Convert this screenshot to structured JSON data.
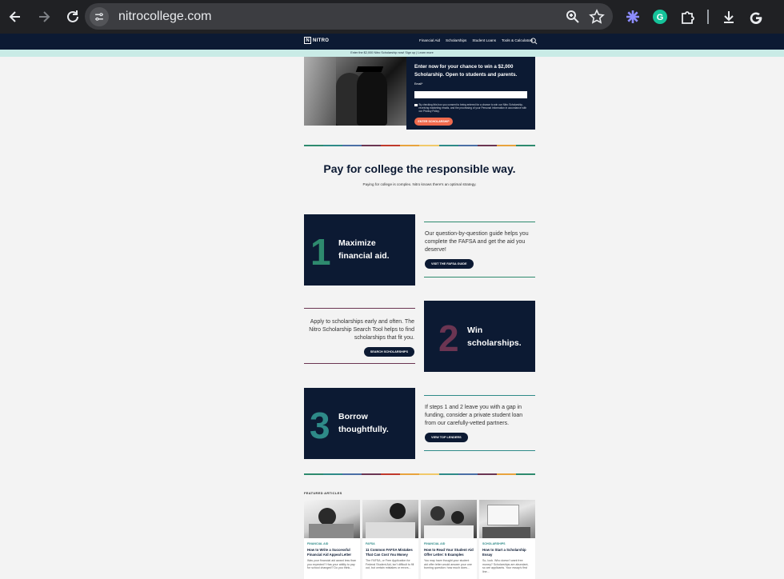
{
  "browser": {
    "url": "nitrocollege.com"
  },
  "site_nav": {
    "logo_text": "NITRO",
    "logo_box": "N",
    "menu": [
      "Financial Aid",
      "Scholarships",
      "Student Loans",
      "Tools & Calculators"
    ]
  },
  "promo_bar": {
    "text": "Enter the $2,000 Nitro Scholarship now! Sign up | Learn more"
  },
  "hero": {
    "title": "Enter now for your chance to win a $2,000 Scholarship. Open to students and parents.",
    "email_label": "Email*",
    "consent": "By checking this box you consent to being entered for a chance to win our Nitro Scholarship, receiving marketing emails, and the processing of your Personal Information in accordance with our Privacy Policy.",
    "button": "ENTER SCHOLARSHIP"
  },
  "section": {
    "heading": "Pay for college the responsible way.",
    "subheading": "Paying for college is complex. Nitro knows there's an optimal strategy."
  },
  "steps": [
    {
      "number": "1",
      "title_line1": "Maximize",
      "title_line2": "financial aid.",
      "description": "Our question-by-question guide helps you complete the FAFSA and get the aid you deserve!",
      "button": "VISIT THE FAFSA GUIDE",
      "accent": "#2e8a6e"
    },
    {
      "number": "2",
      "title_line1": "Win",
      "title_line2": "scholarships.",
      "description": "Apply to scholarships early and often. The Nitro Scholarship Search Tool helps to find scholarships that fit you.",
      "button": "SEARCH SCHOLARSHIPS",
      "accent": "#6b3552"
    },
    {
      "number": "3",
      "title_line1": "Borrow",
      "title_line2": "thoughtfully.",
      "description": "If steps 1 and 2 leave you with a gap in funding, consider a private student loan from our carefully-vetted partners.",
      "button": "VIEW TOP LENDERS",
      "accent": "#2e8a88"
    }
  ],
  "featured": {
    "label": "FEATURED ARTICLES",
    "articles": [
      {
        "category": "FINANCIAL AID",
        "title": "How to Write a Successful Financial Aid Appeal Letter",
        "excerpt": "Was your financial aid award less than you expected? Has your ability to pay for school changed? Do you think..."
      },
      {
        "category": "FAFSA",
        "title": "11 Common FAFSA Mistakes That Can Cost You Money",
        "excerpt": "The FAFSA, or Free Application for Federal Student Aid, isn't difficult to fill out, but certain mistakes or errors..."
      },
      {
        "category": "FINANCIAL AID",
        "title": "How to Read Your Student Aid Offer Letter: 5 Examples",
        "excerpt": "You may have thought your student aid offer letter would answer your one burning question: how much does..."
      },
      {
        "category": "SCHOLARSHIPS",
        "title": "How to Start a Scholarship Essay",
        "excerpt": "So, look. Who doesn't want free money? Scholarships are abundant, so are applicants. Your essay's first line..."
      }
    ]
  },
  "colors": {
    "navy": "#0c1a33",
    "coral": "#f06a4d",
    "mint": "#c9ebe6",
    "rainbow": [
      "#2e8a6e",
      "#2e8a88",
      "#4a6fa5",
      "#6b3552",
      "#c0392b",
      "#e8a33d",
      "#f1c96a",
      "#2e8a88",
      "#4a6fa5",
      "#6b3552",
      "#e8a33d",
      "#2e8a6e"
    ]
  }
}
